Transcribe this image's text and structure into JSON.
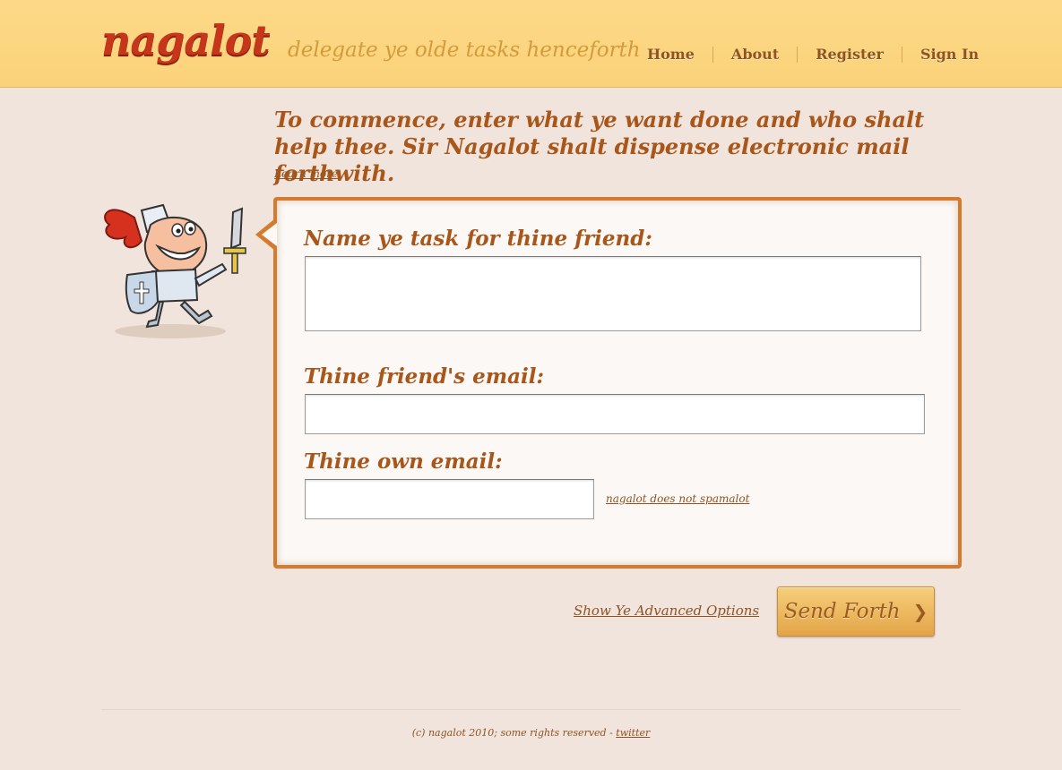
{
  "header": {
    "logo": "nagalot",
    "tagline": "delegate ye olde tasks henceforth",
    "nav": [
      {
        "label": "Home"
      },
      {
        "label": "About"
      },
      {
        "label": "Register"
      },
      {
        "label": "Sign In"
      }
    ]
  },
  "intro": {
    "headline": "To commence, enter what ye want done and who shalt help thee. Sir Nagalot shalt dispense electronic mail forthwith.",
    "learn_more": "Learn more"
  },
  "form": {
    "task_label": "Name ye task for thine friend:",
    "task_value": "",
    "friend_email_label": "Thine friend's email:",
    "friend_email_value": "",
    "own_email_label": "Thine own email:",
    "own_email_value": "",
    "spam_note": "nagalot does not spamalot"
  },
  "actions": {
    "advanced_options": "Show Ye Advanced Options",
    "send_label": "Send Forth",
    "send_chevron": "❯"
  },
  "footer": {
    "copyright": "(c) nagalot 2010; some rights reserved - ",
    "twitter": "twitter"
  },
  "colors": {
    "header_bg": "#fbd27a",
    "page_bg": "#f0e4dc",
    "accent": "#d47b30",
    "heading": "#a9561a",
    "logo": "#c6361a"
  }
}
